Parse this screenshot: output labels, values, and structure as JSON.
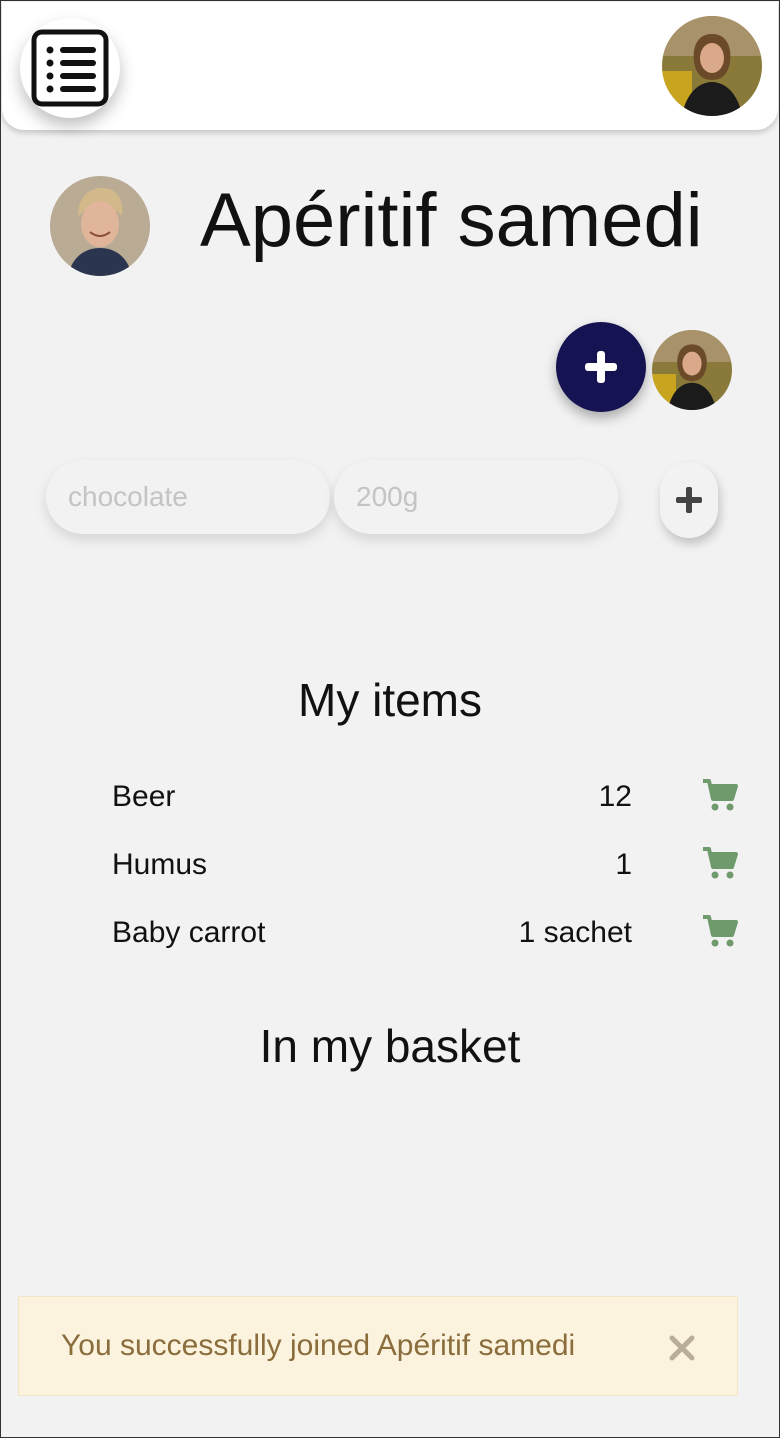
{
  "header": {
    "menu_icon": "list-icon",
    "user_avatar_alt": "Current user avatar"
  },
  "event": {
    "title": "Apéritif samedi",
    "add_member_icon": "plus-icon"
  },
  "add_item_form": {
    "item_placeholder": "chocolate",
    "quantity_placeholder": "200g",
    "item_value": "",
    "quantity_value": "",
    "add_icon": "plus-icon"
  },
  "my_items": {
    "title": "My items",
    "items": [
      {
        "name": "Beer",
        "quantity": "12",
        "icon": "cart-icon"
      },
      {
        "name": "Humus",
        "quantity": "1",
        "icon": "cart-icon"
      },
      {
        "name": "Baby carrot",
        "quantity": "1 sachet",
        "icon": "cart-icon"
      }
    ]
  },
  "basket": {
    "title": "In my basket",
    "items": []
  },
  "toast": {
    "message": "You successfully joined Apéritif samedi",
    "close_icon": "close-icon"
  },
  "colors": {
    "background": "#f2f2f2",
    "primary_button": "#161352",
    "cart_icon": "#6f9a6c",
    "toast_background": "#fcf3df",
    "toast_text": "#8a6d3b"
  }
}
